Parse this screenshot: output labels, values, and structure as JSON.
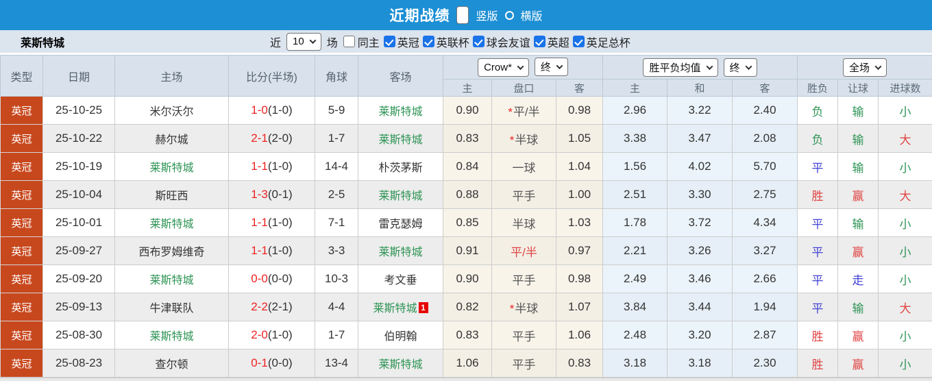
{
  "topbar": {
    "title": "近期战绩",
    "radios": [
      {
        "label": "竖版",
        "selected": true
      },
      {
        "label": "横版",
        "selected": false
      }
    ]
  },
  "filterbar": {
    "team": "莱斯特城",
    "recent_label": "近",
    "count_value": "10",
    "matches_label": "场",
    "same_venue_label": "同主",
    "same_venue_checked": false,
    "leagues": [
      {
        "label": "英冠",
        "checked": true
      },
      {
        "label": "英联杯",
        "checked": true
      },
      {
        "label": "球会友谊",
        "checked": true
      },
      {
        "label": "英超",
        "checked": true
      },
      {
        "label": "英足总杯",
        "checked": true
      }
    ]
  },
  "table": {
    "selects": {
      "company": "Crow*",
      "company_time": "终",
      "avg": "胜平负均值",
      "avg_time": "终",
      "scope": "全场"
    },
    "headers": {
      "type": "类型",
      "date": "日期",
      "home": "主场",
      "score": "比分(半场)",
      "corners": "角球",
      "away": "客场",
      "odds_home": "主",
      "handicap": "盘口",
      "odds_away": "客",
      "avg_home": "主",
      "avg_draw": "和",
      "avg_away": "客",
      "result_wdl": "胜负",
      "result_handicap": "让球",
      "result_goals": "进球数"
    },
    "rows": [
      {
        "league": "英冠",
        "date": "25-10-25",
        "home": "米尔沃尔",
        "home_green": false,
        "score_ft": "1-0",
        "score_ht": "(1-0)",
        "corners": "5-9",
        "away": "莱斯特城",
        "away_green": true,
        "odds_home": "0.90",
        "handicap": "平/半",
        "handicap_star": true,
        "handicap_red": false,
        "odds_away": "0.98",
        "avg_home": "2.96",
        "avg_draw": "3.22",
        "avg_away": "2.40",
        "res_wdl": "负",
        "res_wdl_color": "green",
        "res_let": "输",
        "res_let_color": "green",
        "res_goal": "小",
        "res_goal_color": "green"
      },
      {
        "league": "英冠",
        "date": "25-10-22",
        "home": "赫尔城",
        "home_green": false,
        "score_ft": "2-1",
        "score_ht": "(2-0)",
        "corners": "1-7",
        "away": "莱斯特城",
        "away_green": true,
        "odds_home": "0.83",
        "handicap": "半球",
        "handicap_star": true,
        "handicap_red": false,
        "odds_away": "1.05",
        "avg_home": "3.38",
        "avg_draw": "3.47",
        "avg_away": "2.08",
        "res_wdl": "负",
        "res_wdl_color": "green",
        "res_let": "输",
        "res_let_color": "green",
        "res_goal": "大",
        "res_goal_color": "red"
      },
      {
        "league": "英冠",
        "date": "25-10-19",
        "home": "莱斯特城",
        "home_green": true,
        "score_ft": "1-1",
        "score_ht": "(1-0)",
        "corners": "14-4",
        "away": "朴茨茅斯",
        "away_green": false,
        "odds_home": "0.84",
        "handicap": "一球",
        "handicap_star": false,
        "handicap_red": false,
        "odds_away": "1.04",
        "avg_home": "1.56",
        "avg_draw": "4.02",
        "avg_away": "5.70",
        "res_wdl": "平",
        "res_wdl_color": "blue",
        "res_let": "输",
        "res_let_color": "green",
        "res_goal": "小",
        "res_goal_color": "green"
      },
      {
        "league": "英冠",
        "date": "25-10-04",
        "home": "斯旺西",
        "home_green": false,
        "score_ft": "1-3",
        "score_ht": "(0-1)",
        "corners": "2-5",
        "away": "莱斯特城",
        "away_green": true,
        "odds_home": "0.88",
        "handicap": "平手",
        "handicap_star": false,
        "handicap_red": false,
        "odds_away": "1.00",
        "avg_home": "2.51",
        "avg_draw": "3.30",
        "avg_away": "2.75",
        "res_wdl": "胜",
        "res_wdl_color": "red",
        "res_let": "赢",
        "res_let_color": "red",
        "res_goal": "大",
        "res_goal_color": "red"
      },
      {
        "league": "英冠",
        "date": "25-10-01",
        "home": "莱斯特城",
        "home_green": true,
        "score_ft": "1-1",
        "score_ht": "(1-0)",
        "corners": "7-1",
        "away": "雷克瑟姆",
        "away_green": false,
        "odds_home": "0.85",
        "handicap": "半球",
        "handicap_star": false,
        "handicap_red": false,
        "odds_away": "1.03",
        "avg_home": "1.78",
        "avg_draw": "3.72",
        "avg_away": "4.34",
        "res_wdl": "平",
        "res_wdl_color": "blue",
        "res_let": "输",
        "res_let_color": "green",
        "res_goal": "小",
        "res_goal_color": "green"
      },
      {
        "league": "英冠",
        "date": "25-09-27",
        "home": "西布罗姆维奇",
        "home_green": false,
        "score_ft": "1-1",
        "score_ht": "(1-0)",
        "corners": "3-3",
        "away": "莱斯特城",
        "away_green": true,
        "odds_home": "0.91",
        "handicap": "平/半",
        "handicap_star": false,
        "handicap_red": true,
        "odds_away": "0.97",
        "avg_home": "2.21",
        "avg_draw": "3.26",
        "avg_away": "3.27",
        "res_wdl": "平",
        "res_wdl_color": "blue",
        "res_let": "赢",
        "res_let_color": "red",
        "res_goal": "小",
        "res_goal_color": "green"
      },
      {
        "league": "英冠",
        "date": "25-09-20",
        "home": "莱斯特城",
        "home_green": true,
        "score_ft": "0-0",
        "score_ht": "(0-0)",
        "corners": "10-3",
        "away": "考文垂",
        "away_green": false,
        "odds_home": "0.90",
        "handicap": "平手",
        "handicap_star": false,
        "handicap_red": false,
        "odds_away": "0.98",
        "avg_home": "2.49",
        "avg_draw": "3.46",
        "avg_away": "2.66",
        "res_wdl": "平",
        "res_wdl_color": "blue",
        "res_let": "走",
        "res_let_color": "blue",
        "res_goal": "小",
        "res_goal_color": "green"
      },
      {
        "league": "英冠",
        "date": "25-09-13",
        "home": "牛津联队",
        "home_green": false,
        "score_ft": "2-2",
        "score_ht": "(2-1)",
        "corners": "4-4",
        "away": "莱斯特城",
        "away_green": true,
        "away_badge": "1",
        "odds_home": "0.82",
        "handicap": "半球",
        "handicap_star": true,
        "handicap_red": false,
        "odds_away": "1.07",
        "avg_home": "3.84",
        "avg_draw": "3.44",
        "avg_away": "1.94",
        "res_wdl": "平",
        "res_wdl_color": "blue",
        "res_let": "输",
        "res_let_color": "green",
        "res_goal": "大",
        "res_goal_color": "red"
      },
      {
        "league": "英冠",
        "date": "25-08-30",
        "home": "莱斯特城",
        "home_green": true,
        "score_ft": "2-0",
        "score_ht": "(1-0)",
        "corners": "1-7",
        "away": "伯明翰",
        "away_green": false,
        "odds_home": "0.83",
        "handicap": "平手",
        "handicap_star": false,
        "handicap_red": false,
        "odds_away": "1.06",
        "avg_home": "2.48",
        "avg_draw": "3.20",
        "avg_away": "2.87",
        "res_wdl": "胜",
        "res_wdl_color": "red",
        "res_let": "赢",
        "res_let_color": "red",
        "res_goal": "小",
        "res_goal_color": "green"
      },
      {
        "league": "英冠",
        "date": "25-08-23",
        "home": "查尔顿",
        "home_green": false,
        "score_ft": "0-1",
        "score_ht": "(0-0)",
        "corners": "13-4",
        "away": "莱斯特城",
        "away_green": true,
        "odds_home": "1.06",
        "handicap": "平手",
        "handicap_star": false,
        "handicap_red": false,
        "odds_away": "0.83",
        "avg_home": "3.18",
        "avg_draw": "3.18",
        "avg_away": "2.30",
        "res_wdl": "胜",
        "res_wdl_color": "red",
        "res_let": "赢",
        "res_let_color": "red",
        "res_goal": "小",
        "res_goal_color": "green"
      }
    ]
  },
  "accents": {
    "topbar_blue": "#1d8fd4",
    "league_badge_red": "#c8481e",
    "win_red": "#e04545",
    "draw_blue": "#4343d6",
    "loss_green": "#2e9455",
    "score_red": "#ee2222",
    "odds_bg": "#f8f4ea",
    "avg_bg": "#ebf4fb"
  }
}
